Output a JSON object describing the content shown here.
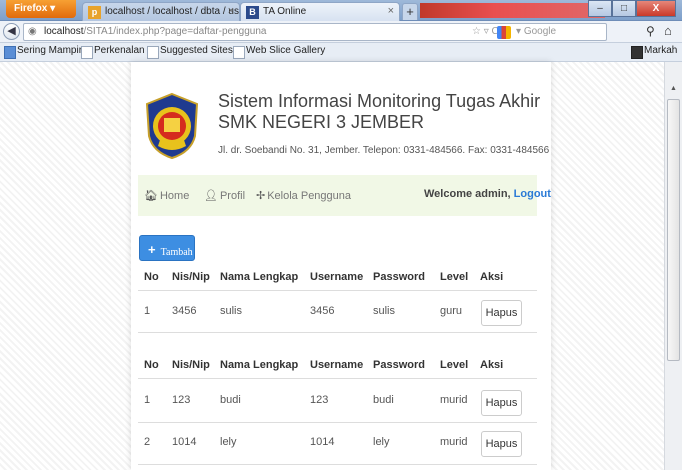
{
  "browser": {
    "menu_label": "Firefox",
    "tabs": [
      {
        "title": "localhost / localhost / dbta / user | ph...",
        "icon": "PMA"
      },
      {
        "title": "TA Online",
        "icon": "B"
      }
    ],
    "url_host": "localhost",
    "url_path": "/SITA1/index.php?page=daftar-pengguna",
    "search_placeholder": "Google",
    "bookmarks": [
      "Sering Mampir",
      "Perkenalan",
      "Suggested Sites",
      "Web Slice Gallery"
    ],
    "bookmarks_right": "Markah"
  },
  "site": {
    "title_line1": "Sistem Informasi Monitoring Tugas Akhir",
    "title_line2": "SMK NEGERI 3 JEMBER",
    "address": "Jl. dr. Soebandi No. 31, Jember. Telepon: 0331-484566. Fax: 0331-484566"
  },
  "nav": {
    "home": "Home",
    "profil": "Profil",
    "kelola": "Kelola Pengguna",
    "welcome": "Welcome admin,",
    "logout": "Logout"
  },
  "add_button": "Tambah",
  "headers": [
    "No",
    "Nis/Nip",
    "Nama Lengkap",
    "Username",
    "Password",
    "Level",
    "Aksi"
  ],
  "table_guru": [
    {
      "no": "1",
      "nis": "3456",
      "nama": "sulis",
      "username": "3456",
      "password": "sulis",
      "level": "guru",
      "aksi": "Hapus"
    }
  ],
  "table_murid": [
    {
      "no": "1",
      "nis": "123",
      "nama": "budi",
      "username": "123",
      "password": "budi",
      "level": "murid",
      "aksi": "Hapus"
    },
    {
      "no": "2",
      "nis": "1014",
      "nama": "lely",
      "username": "1014",
      "password": "lely",
      "level": "murid",
      "aksi": "Hapus"
    }
  ]
}
